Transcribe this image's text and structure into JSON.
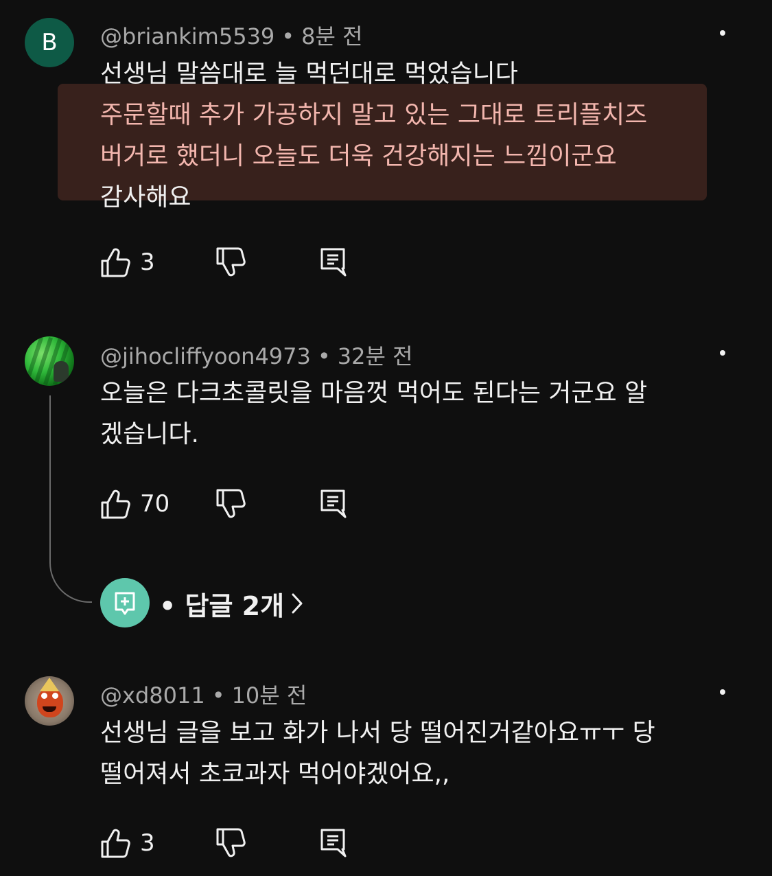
{
  "comments": [
    {
      "avatar_letter": "B",
      "handle": "@briankim5539",
      "time": "8분 전",
      "lines": [
        "선생님 말씀대로 늘 먹던대로 먹었습니다",
        "주문할때 추가 가공하지 말고 있는 그대로 트리플치즈",
        "버거로 했더니 오늘도 더욱 건강해지는 느낌이군요",
        "감사해요"
      ],
      "like_count": "3"
    },
    {
      "handle": "@jihocliffyoon4973",
      "time": "32분 전",
      "lines": [
        "오늘은 다크초콜릿을 마음껏 먹어도 된다는 거군요 알",
        "겠습니다."
      ],
      "like_count": "70",
      "replies_label": "• 답글 2개"
    },
    {
      "handle": "@xd8011",
      "time": "10분 전",
      "lines": [
        "선생님 글을 보고 화가 나서 당 떨어진거같아요ㅠㅜ 당",
        "떨어져서 초코과자 먹어야겠어요,,"
      ],
      "like_count": "3"
    }
  ],
  "meta_separator": "•",
  "icons": {
    "like": "thumbs-up-icon",
    "dislike": "thumbs-down-icon",
    "reply": "comment-reply-icon",
    "more": "more-vertical-icon",
    "chevron": "chevron-right-icon"
  },
  "colors": {
    "background": "#0f0f0f",
    "text": "#f1f1f1",
    "secondary_text": "#aaaaaa",
    "avatar_b": "#0e5a46",
    "replies_avatar": "#5ec7ac"
  }
}
